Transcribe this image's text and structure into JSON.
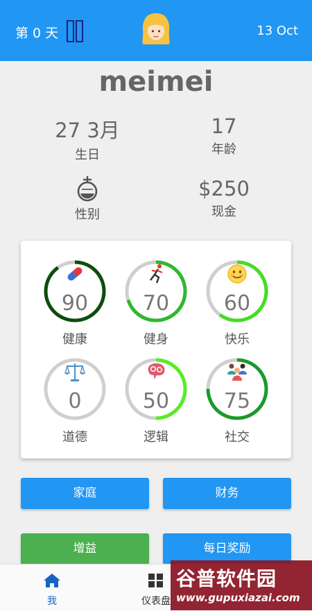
{
  "header": {
    "day_label": "第 0 天",
    "date": "13 Oct"
  },
  "profile": {
    "name": "meimei",
    "birthday_value": "27 3月",
    "birthday_label": "生日",
    "age_value": "17",
    "age_label": "年龄",
    "gender_label": "性别",
    "cash_value": "$250",
    "cash_label": "现金"
  },
  "stats": [
    {
      "label": "健康",
      "value": "90",
      "percent": 90,
      "color": "#0d4d0d",
      "icon": "pill-icon"
    },
    {
      "label": "健身",
      "value": "70",
      "percent": 70,
      "color": "#2eb82e",
      "icon": "running-icon"
    },
    {
      "label": "快乐",
      "value": "60",
      "percent": 60,
      "color": "#44dd22",
      "icon": "smiley-icon"
    },
    {
      "label": "道德",
      "value": "0",
      "percent": 0,
      "color": "#2eb82e",
      "icon": "scales-icon"
    },
    {
      "label": "逻辑",
      "value": "50",
      "percent": 50,
      "color": "#55ee22",
      "icon": "brain-gears-icon"
    },
    {
      "label": "社交",
      "value": "75",
      "percent": 75,
      "color": "#1a9a2a",
      "icon": "people-icon"
    }
  ],
  "buttons": {
    "family": "家庭",
    "finance": "财务",
    "boost": "增益",
    "daily_reward": "每日奖励"
  },
  "nav": {
    "me": "我",
    "dashboard": "仪表盘"
  },
  "watermark": {
    "main": "谷普软件园",
    "sub": "www.gupuxiazai.com"
  },
  "colors": {
    "primary": "#2196f3",
    "green_button": "#4caf50"
  }
}
